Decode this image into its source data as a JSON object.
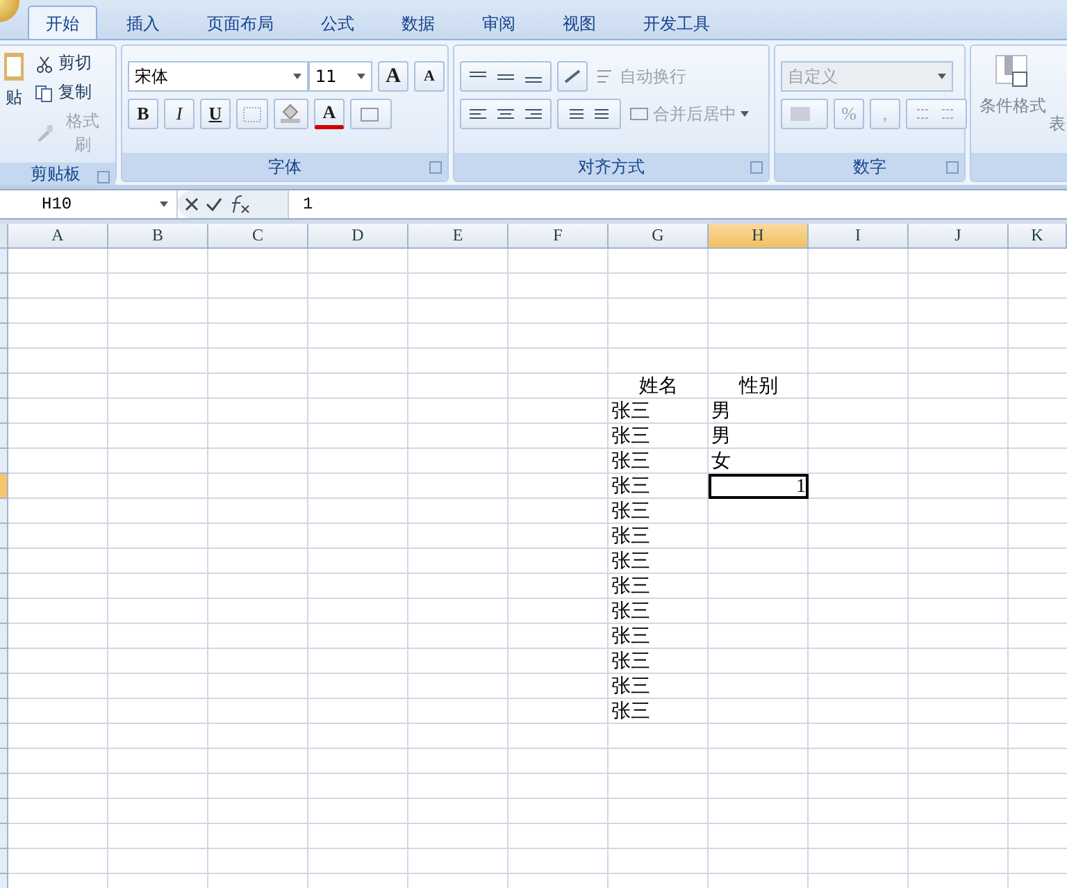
{
  "tabs": [
    {
      "label": "开始",
      "selected": true
    },
    {
      "label": "插入",
      "selected": false
    },
    {
      "label": "页面布局",
      "selected": false
    },
    {
      "label": "公式",
      "selected": false
    },
    {
      "label": "数据",
      "selected": false
    },
    {
      "label": "审阅",
      "selected": false
    },
    {
      "label": "视图",
      "selected": false
    },
    {
      "label": "开发工具",
      "selected": false
    }
  ],
  "ribbon": {
    "clipboard": {
      "title": "剪贴板",
      "paste_label": "贴",
      "items": [
        {
          "kind": "cut",
          "label": "剪切",
          "disabled": false
        },
        {
          "kind": "copy",
          "label": "复制",
          "disabled": false
        },
        {
          "kind": "painter",
          "label": "格式刷",
          "disabled": true
        }
      ]
    },
    "font": {
      "title": "字体",
      "font_name": "宋体",
      "font_size": "11",
      "size_buttons": [
        {
          "kind": "grow",
          "label": "A"
        },
        {
          "kind": "shrink",
          "label": "A"
        }
      ],
      "styles": [
        {
          "kind": "bold",
          "label": "B"
        },
        {
          "kind": "italic",
          "label": "I"
        },
        {
          "kind": "underline",
          "label": "U"
        }
      ],
      "font_color_label": "A"
    },
    "alignment": {
      "title": "对齐方式",
      "wrap_text": {
        "label": "自动换行",
        "disabled": true
      },
      "merge": {
        "label": "合并后居中",
        "disabled": true
      }
    },
    "number": {
      "title": "数字",
      "format": {
        "value": "自定义",
        "disabled": true
      },
      "buttons": [
        {
          "label": "%"
        },
        {
          "label": ","
        }
      ]
    },
    "styles": {
      "conditional_format": "条件格式",
      "table_format": "表"
    }
  },
  "formula_bar": {
    "name_box": "H10",
    "content": "1"
  },
  "sheet": {
    "columns": [
      {
        "label": "A",
        "selected": false
      },
      {
        "label": "B",
        "selected": false
      },
      {
        "label": "C",
        "selected": false
      },
      {
        "label": "D",
        "selected": false
      },
      {
        "label": "E",
        "selected": false
      },
      {
        "label": "F",
        "selected": false
      },
      {
        "label": "G",
        "selected": false
      },
      {
        "label": "H",
        "selected": true
      },
      {
        "label": "I",
        "selected": false
      },
      {
        "label": "J",
        "selected": false
      },
      {
        "label": "K",
        "selected": false
      }
    ],
    "rows": [
      {
        "selected": false
      },
      {
        "selected": false
      },
      {
        "selected": false
      },
      {
        "selected": false
      },
      {
        "selected": false
      },
      {
        "selected": false,
        "g": {
          "text": "姓名",
          "kind": "heading"
        },
        "h": {
          "text": "性别",
          "kind": "heading"
        }
      },
      {
        "selected": false,
        "g": {
          "text": "张三",
          "kind": "text"
        },
        "h": {
          "text": "男",
          "kind": "text"
        }
      },
      {
        "selected": false,
        "g": {
          "text": "张三",
          "kind": "text"
        },
        "h": {
          "text": "男",
          "kind": "text"
        }
      },
      {
        "selected": false,
        "g": {
          "text": "张三",
          "kind": "text"
        },
        "h": {
          "text": "女",
          "kind": "text"
        }
      },
      {
        "selected": true,
        "g": {
          "text": "张三",
          "kind": "text"
        },
        "h": {
          "text": "1",
          "kind": "number",
          "active": true
        }
      },
      {
        "selected": false,
        "g": {
          "text": "张三",
          "kind": "text"
        }
      },
      {
        "selected": false,
        "g": {
          "text": "张三",
          "kind": "text"
        }
      },
      {
        "selected": false,
        "g": {
          "text": "张三",
          "kind": "text"
        }
      },
      {
        "selected": false,
        "g": {
          "text": "张三",
          "kind": "text"
        }
      },
      {
        "selected": false,
        "g": {
          "text": "张三",
          "kind": "text"
        }
      },
      {
        "selected": false,
        "g": {
          "text": "张三",
          "kind": "text"
        }
      },
      {
        "selected": false,
        "g": {
          "text": "张三",
          "kind": "text"
        }
      },
      {
        "selected": false,
        "g": {
          "text": "张三",
          "kind": "text"
        }
      },
      {
        "selected": false,
        "g": {
          "text": "张三",
          "kind": "text"
        }
      },
      {
        "selected": false
      },
      {
        "selected": false
      },
      {
        "selected": false
      },
      {
        "selected": false
      },
      {
        "selected": false
      },
      {
        "selected": false
      },
      {
        "selected": false
      }
    ]
  }
}
